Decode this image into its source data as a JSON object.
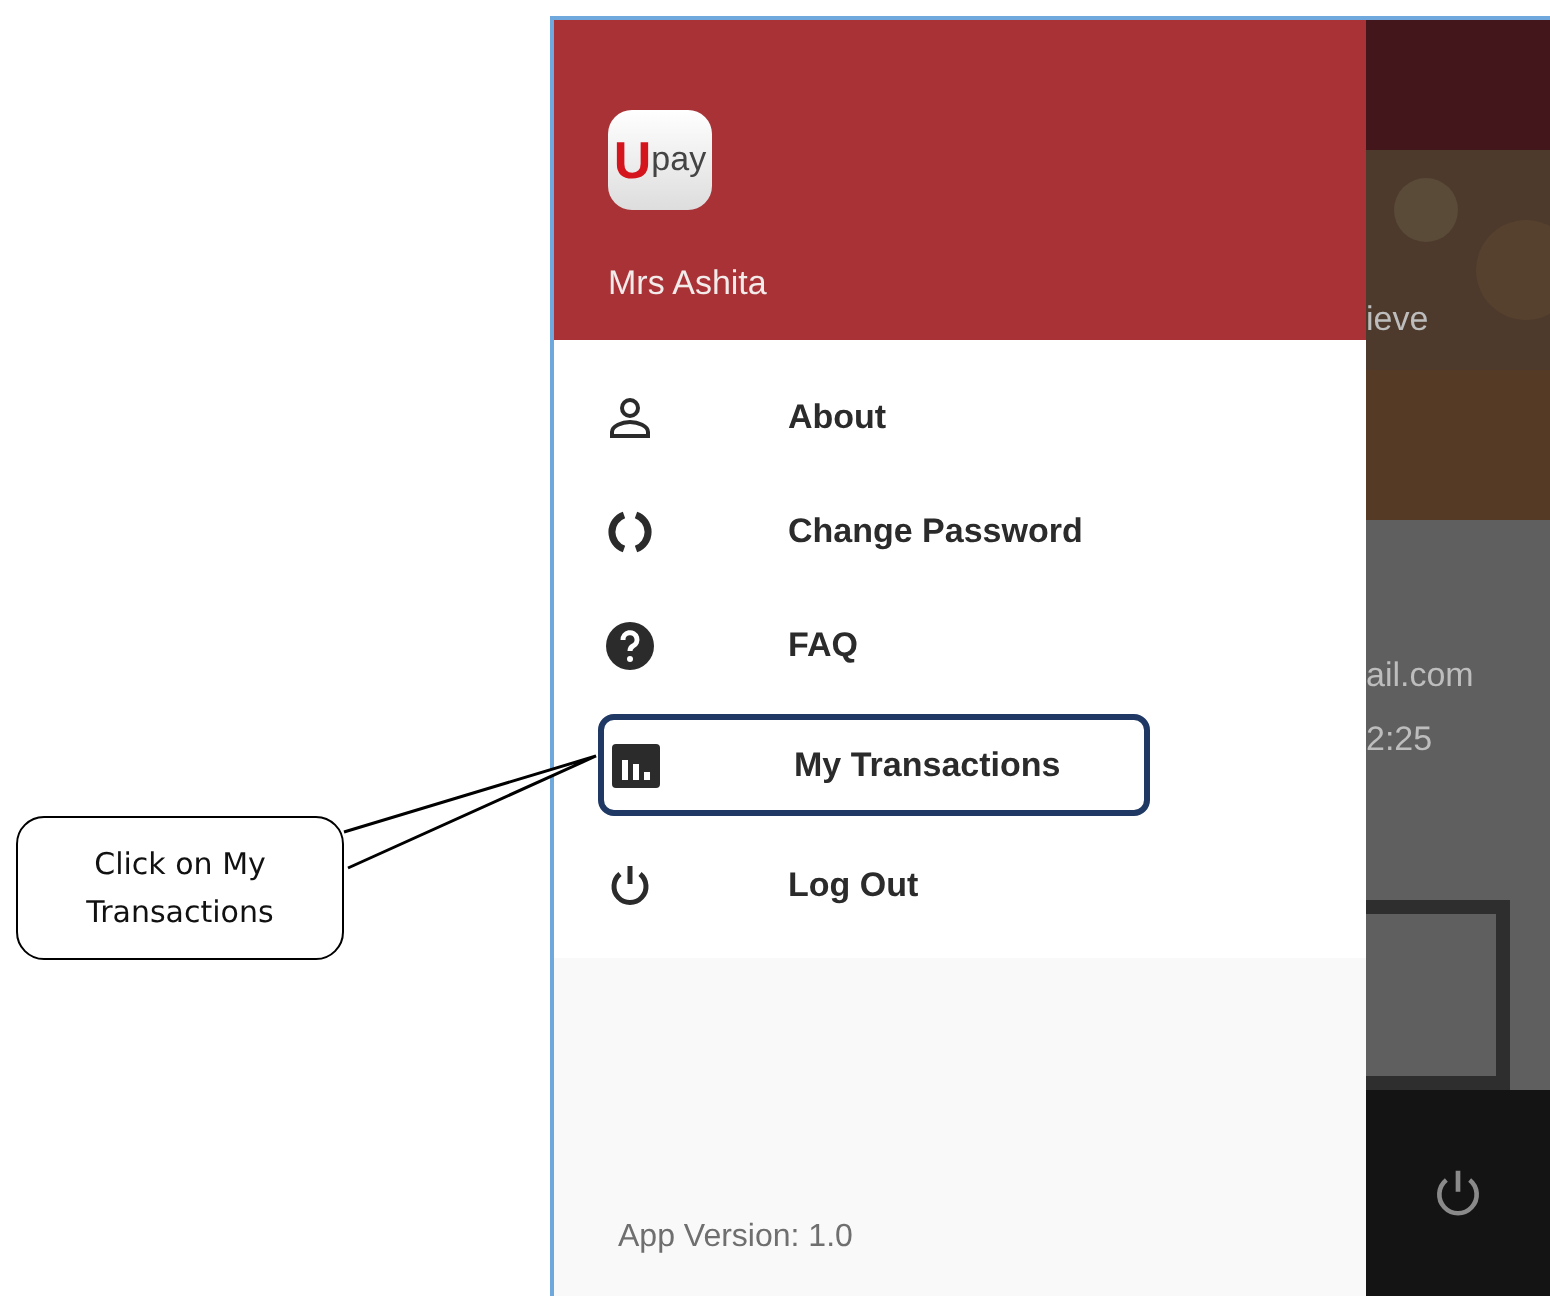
{
  "drawer": {
    "logo": {
      "initial": "U",
      "text": "pay"
    },
    "user_name": "Mrs Ashita",
    "items": [
      {
        "kind": "person",
        "label": "About",
        "highlighted": false
      },
      {
        "kind": "ring",
        "label": "Change Password",
        "highlighted": false
      },
      {
        "kind": "question",
        "label": "FAQ",
        "highlighted": false
      },
      {
        "kind": "chart",
        "label": "My Transactions",
        "highlighted": true
      },
      {
        "kind": "power",
        "label": "Log Out",
        "highlighted": false
      }
    ],
    "version": "App Version: 1.0"
  },
  "background": {
    "texts": [
      "ieve",
      "ail.com",
      "2:25"
    ]
  },
  "callout": {
    "text": "Click on My Transactions"
  }
}
